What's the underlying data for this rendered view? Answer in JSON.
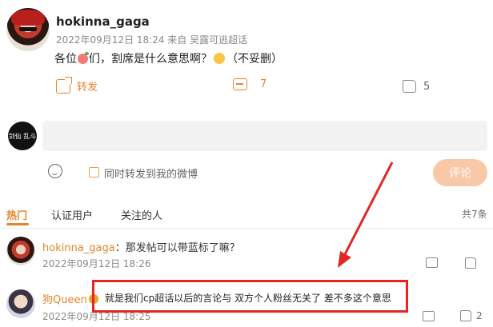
{
  "post": {
    "username": "hokinna_gaga",
    "meta": "2022年09月12日 18:24 来自 吴露可逃超话",
    "text_before": "各位",
    "text_middle": "们，割席是什么意思啊？",
    "text_after": "（不妥删）",
    "repost_label": "转发",
    "comment_count": "7",
    "like_count": "5"
  },
  "composer": {
    "avatar_text": "剑仙 乱斗",
    "input_placeholder": "",
    "sync_label": "同时转发到我的微博",
    "submit_label": "评论"
  },
  "tabs": {
    "hot": "热门",
    "verified": "认证用户",
    "following": "关注的人",
    "total": "共7条"
  },
  "comments": [
    {
      "name": "hokinna_gaga",
      "text": "：那发帖可以带蓝标了嘛？",
      "time": "2022年09月12日 18:26",
      "like": ""
    },
    {
      "name": "狗Queen",
      "text": "：就是我们cp超话以后的言论与 双方个人粉丝无关了 差不多这个意思",
      "time": "2022年09月12日 18:25",
      "like": "2"
    }
  ],
  "annotation": {
    "highlight_text": "就是我们cp超话以后的言论与 双方个人粉丝无关了 差不多这个意思",
    "color": "#e32621"
  },
  "colors": {
    "accent": "#e6842a",
    "submit_bg": "#f9c9a7"
  }
}
